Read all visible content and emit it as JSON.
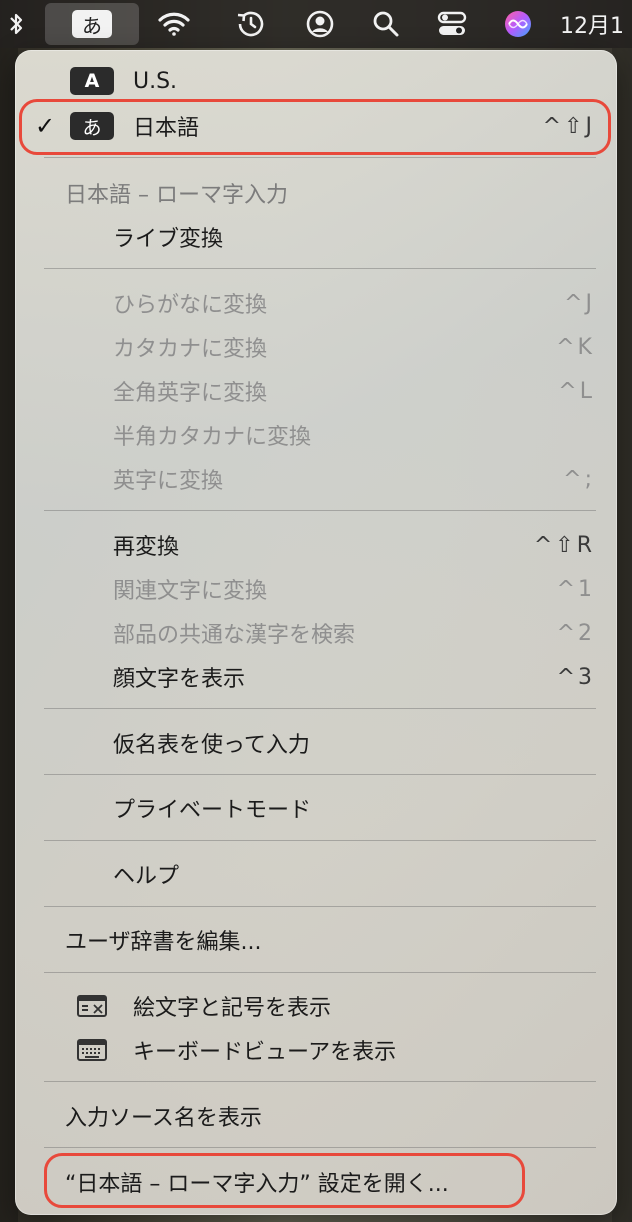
{
  "menubar": {
    "ime_glyph": "あ",
    "clock": "12月1"
  },
  "input_sources": [
    {
      "badge": "A",
      "label": "U.S.",
      "selected": false,
      "shortcut": ""
    },
    {
      "badge": "あ",
      "label": "日本語",
      "selected": true,
      "shortcut": "^⇧J"
    }
  ],
  "mode_section": {
    "heading": "日本語 – ローマ字入力",
    "live_conversion": "ライブ変換"
  },
  "convert_items": [
    {
      "label": "ひらがなに変換",
      "shortcut": "^J"
    },
    {
      "label": "カタカナに変換",
      "shortcut": "^K"
    },
    {
      "label": "全角英字に変換",
      "shortcut": "^L"
    },
    {
      "label": "半角カタカナに変換",
      "shortcut": ""
    },
    {
      "label": "英字に変換",
      "shortcut": "^;"
    }
  ],
  "edit_items": [
    {
      "label": "再変換",
      "shortcut": "^⇧R",
      "enabled": true
    },
    {
      "label": "関連文字に変換",
      "shortcut": "^1",
      "enabled": false
    },
    {
      "label": "部品の共通な漢字を検索",
      "shortcut": "^2",
      "enabled": false
    },
    {
      "label": "顔文字を表示",
      "shortcut": "^3",
      "enabled": true
    }
  ],
  "kana_table": "仮名表を使って入力",
  "private_mode": "プライベートモード",
  "help": "ヘルプ",
  "user_dictionary": "ユーザ辞書を編集...",
  "emoji_symbols": "絵文字と記号を表示",
  "keyboard_viewer": "キーボードビューアを表示",
  "show_source_name": "入力ソース名を表示",
  "open_settings": "“日本語 – ローマ字入力” 設定を開く...",
  "colors": {
    "highlight": "#e8493b",
    "disabled_text": "#8f8f8f"
  }
}
